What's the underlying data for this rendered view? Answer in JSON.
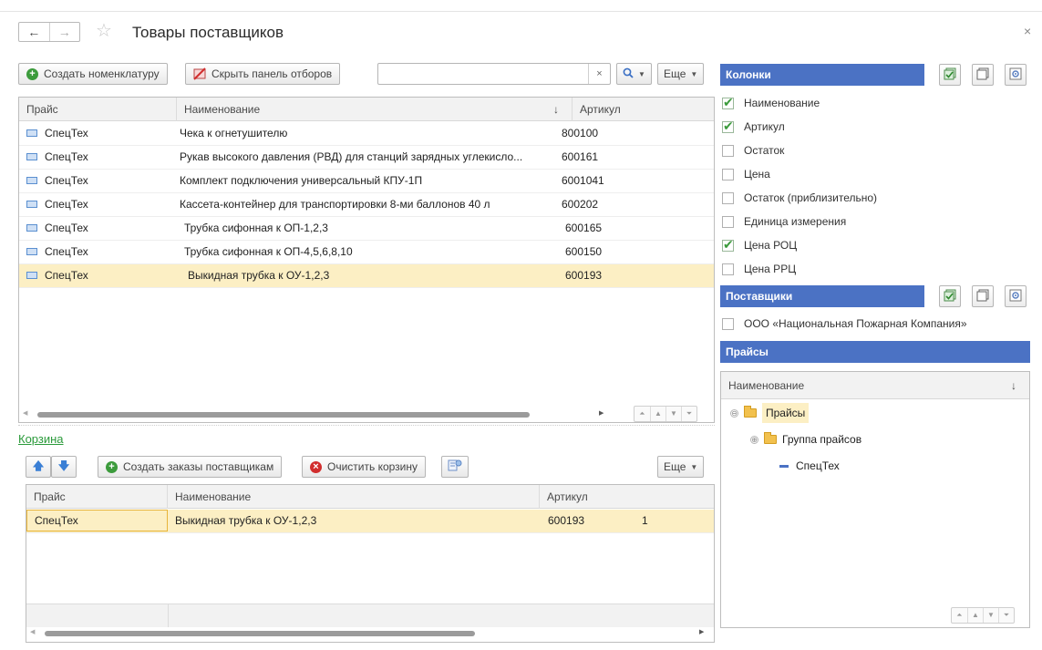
{
  "window": {
    "title": "Товары поставщиков",
    "close_glyph": "×",
    "back_glyph": "←",
    "forward_glyph": "→",
    "star_glyph": "☆"
  },
  "toolbar": {
    "create_item_label": "Создать номенклатуру",
    "hide_filters_label": "Скрыть панель отборов",
    "search_value": "",
    "search_clear": "×",
    "more_label": "Еще"
  },
  "products_table": {
    "columns": [
      "Прайс",
      "Наименование",
      "Артикул"
    ],
    "sort_indicator": "↓",
    "rows": [
      {
        "price": "СпецТех",
        "name": "Чека к огнетушителю",
        "article": "800100",
        "selected": false
      },
      {
        "price": "СпецТех",
        "name": "Рукав высокого давления (РВД) для станций зарядных углекисло...",
        "article": "600161",
        "selected": false
      },
      {
        "price": "СпецТех",
        "name": "Комплект подключения универсальный КПУ-1П",
        "article": "6001041",
        "selected": false
      },
      {
        "price": "СпецТех",
        "name": "Кассета-контейнер для транспортировки 8-ми баллонов 40 л",
        "article": "600202",
        "selected": false
      },
      {
        "price": "СпецТех",
        "name": "Трубка сифонная к ОП-1,2,3",
        "article": "600165",
        "selected": false
      },
      {
        "price": "СпецТех",
        "name": "Трубка сифонная к ОП-4,5,6,8,10",
        "article": "600150",
        "selected": false
      },
      {
        "price": "СпецТех",
        "name": "Выкидная трубка к ОУ-1,2,3",
        "article": "600193",
        "selected": true
      }
    ]
  },
  "cart": {
    "title": "Корзина",
    "create_orders_label": "Создать заказы поставщикам",
    "clear_label": "Очистить корзину",
    "more_label": "Еще",
    "columns": [
      "Прайс",
      "Наименование",
      "Артикул"
    ],
    "rows": [
      {
        "price": "СпецТех",
        "name": "Выкидная трубка к ОУ-1,2,3",
        "article": "600193",
        "qty": "1"
      }
    ]
  },
  "columns_panel": {
    "title": "Колонки",
    "items": [
      {
        "label": "Наименование",
        "checked": true
      },
      {
        "label": "Артикул",
        "checked": true
      },
      {
        "label": "Остаток",
        "checked": false
      },
      {
        "label": "Цена",
        "checked": false
      },
      {
        "label": "Остаток (приблизительно)",
        "checked": false
      },
      {
        "label": "Единица измерения",
        "checked": false
      },
      {
        "label": "Цена РОЦ",
        "checked": true
      },
      {
        "label": "Цена РРЦ",
        "checked": false
      }
    ]
  },
  "suppliers_panel": {
    "title": "Поставщики",
    "items": [
      {
        "label": "ООО «Национальная Пожарная Компания»",
        "checked": false
      }
    ]
  },
  "prices_panel": {
    "title": "Прайсы",
    "column": "Наименование",
    "sort_indicator": "↓",
    "tree": [
      {
        "label": "Прайсы",
        "level": 0,
        "kind": "folder",
        "expander": "⊖",
        "highlight": true
      },
      {
        "label": "Группа прайсов",
        "level": 1,
        "kind": "folder",
        "expander": "⊕",
        "highlight": false
      },
      {
        "label": "СпецТех",
        "level": 2,
        "kind": "item",
        "expander": "",
        "highlight": false
      }
    ]
  },
  "colors": {
    "panel_header": "#4b72c4",
    "selection": "#fcefc4",
    "link": "#2a9a3a"
  }
}
